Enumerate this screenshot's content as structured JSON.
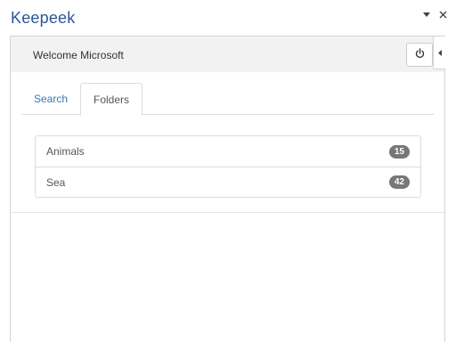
{
  "pane": {
    "title": "Keepeek",
    "controls": [
      {
        "icon": "chevron-down-icon"
      },
      {
        "icon": "close-icon"
      }
    ]
  },
  "header": {
    "welcome_text": "Welcome Microsoft",
    "logout_icon": "power-icon"
  },
  "side_toggle": {
    "icon": "caret-left-icon"
  },
  "tabs": [
    {
      "label": "Search",
      "active": false
    },
    {
      "label": "Folders",
      "active": true
    }
  ],
  "folders": [
    {
      "name": "Animals",
      "count": "15"
    },
    {
      "name": "Sea",
      "count": "42"
    }
  ],
  "colors": {
    "title": "#2b579a",
    "link": "#337ab7",
    "badge": "#777777",
    "header_bg": "#f2f2f2"
  }
}
